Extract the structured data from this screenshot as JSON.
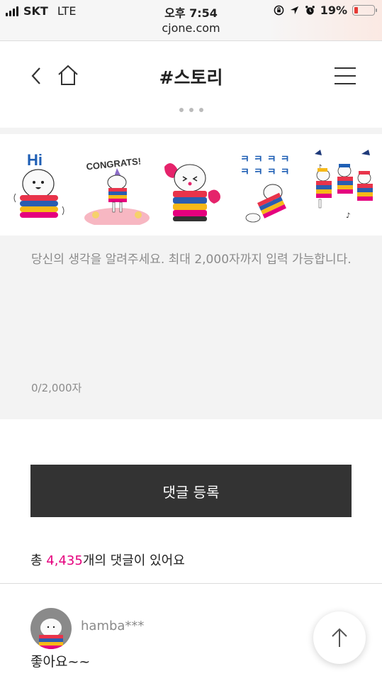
{
  "status_bar": {
    "carrier": "SKT",
    "network": "LTE",
    "time": "오후 7:54",
    "url": "cjone.com",
    "battery": "19%",
    "battery_level": 0.19
  },
  "header": {
    "title": "#스토리"
  },
  "stickers": [
    {
      "name": "hi-sticker",
      "caption": "Hi"
    },
    {
      "name": "congrats-sticker",
      "caption": "CONGRATS!"
    },
    {
      "name": "kiss-sticker",
      "caption": ""
    },
    {
      "name": "laugh-sticker",
      "caption": "ㅋㅋㅋㅋ"
    },
    {
      "name": "dance-sticker",
      "caption": ""
    }
  ],
  "comment_form": {
    "placeholder": "당신의 생각을 알려주세요. 최대 2,000자까지 입력 가능합니다.",
    "counter": "0/2,000자",
    "submit_label": "댓글 등록"
  },
  "summary": {
    "prefix": "총 ",
    "count": "4,435",
    "suffix": "개의 댓글이 있어요"
  },
  "comments": [
    {
      "user": "hamba***",
      "text": "좋아요~~"
    }
  ],
  "colors": {
    "accent": "#e5007e",
    "button": "#333333",
    "input_bg": "#f3f3f3"
  }
}
